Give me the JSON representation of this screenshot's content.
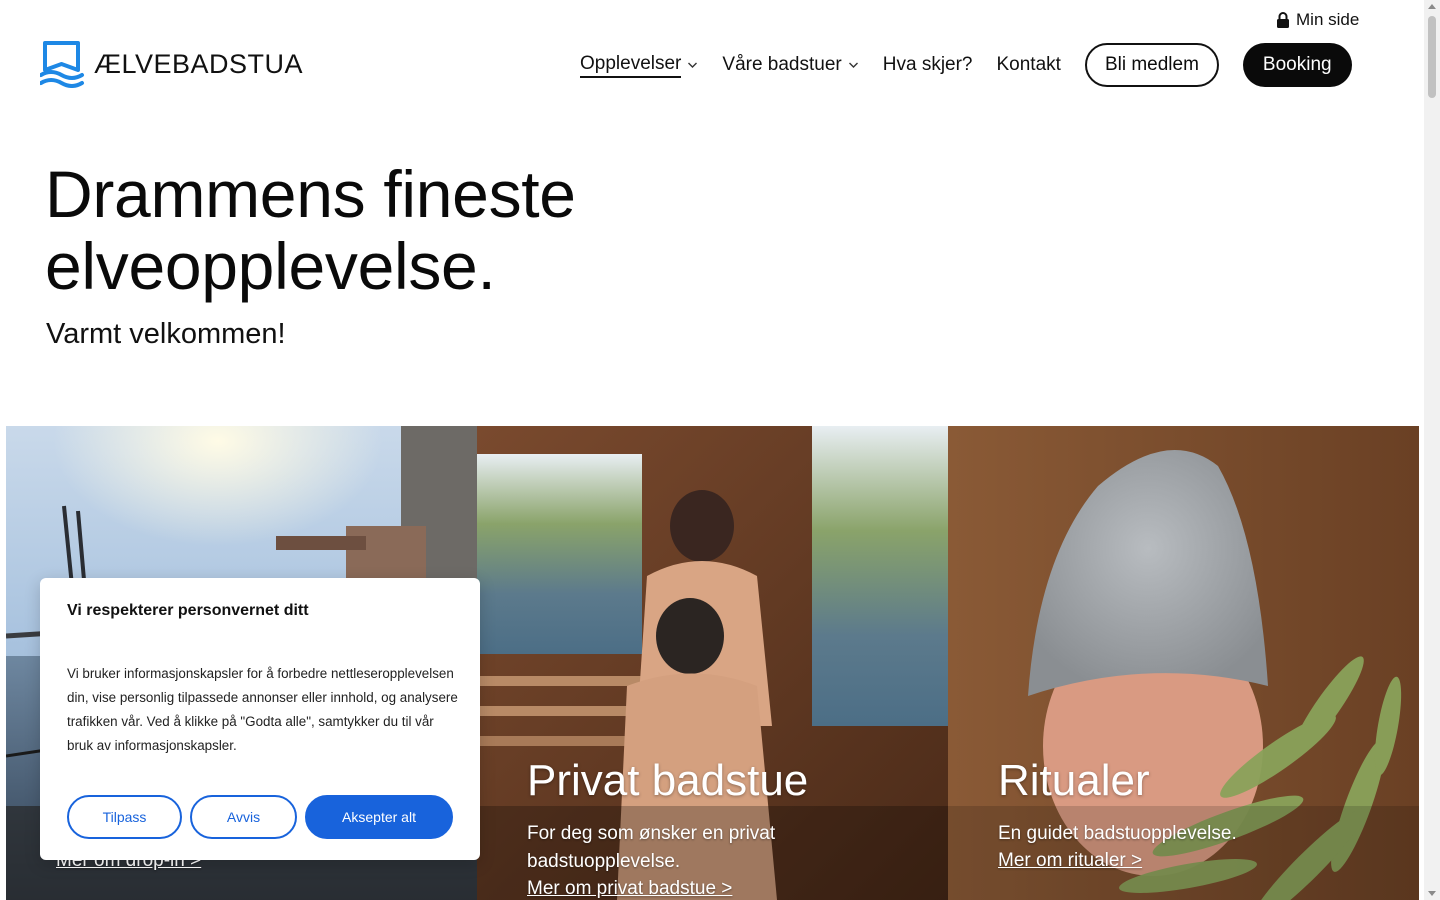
{
  "header": {
    "logo_text": "ÆLVEBADSTUA",
    "logo_icon": "river-flag-logo",
    "min_side": "Min side",
    "nav": [
      {
        "label": "Opplevelser",
        "has_dropdown": true,
        "active": true
      },
      {
        "label": "Våre badstuer",
        "has_dropdown": true,
        "active": false
      },
      {
        "label": "Hva skjer?",
        "has_dropdown": false,
        "active": false
      },
      {
        "label": "Kontakt",
        "has_dropdown": false,
        "active": false
      }
    ],
    "member_button": "Bli medlem",
    "booking_button": "Booking"
  },
  "hero": {
    "title_line1": "Drammens fineste",
    "title_line2": "elveopplevelse.",
    "subtitle": "Varmt velkommen!"
  },
  "cards": [
    {
      "title": "",
      "description": "",
      "link": "Mer om drop-in >"
    },
    {
      "title": "Privat badstue",
      "description": "For deg som ønsker en privat badstuopplevelse.",
      "link": "Mer om privat badstue >"
    },
    {
      "title": "Ritualer",
      "description": "En guidet badstuopplevelse.",
      "link": "Mer om ritualer >"
    }
  ],
  "cookie": {
    "title": "Vi respekterer personvernet ditt",
    "text": "Vi bruker informasjonskapsler for å forbedre nettleseropplevelsen din, vise personlig tilpassede annonser eller innhold, og analysere trafikken vår. Ved å klikke på \"Godta alle\", samtykker du til vår bruk av informasjonskapsler.",
    "customize": "Tilpass",
    "reject": "Avvis",
    "accept": "Aksepter alt"
  },
  "colors": {
    "brand_blue": "#1e88e5",
    "cookie_blue": "#1863dc",
    "black": "#0a0a0a"
  }
}
